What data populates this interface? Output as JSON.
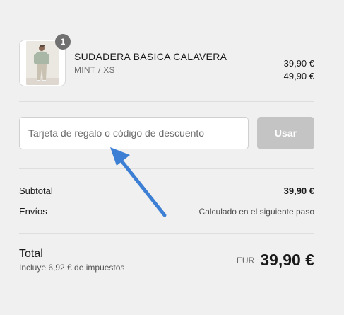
{
  "product": {
    "quantity": "1",
    "name": "SUDADERA BÁSICA CALAVERA",
    "variant": "MINT / XS",
    "price": "39,90 €",
    "original_price": "49,90 €",
    "image_icon": "product-photo"
  },
  "discount": {
    "placeholder": "Tarjeta de regalo o código de descuento",
    "value": "",
    "apply_label": "Usar"
  },
  "subtotal": {
    "label": "Subtotal",
    "value": "39,90 €"
  },
  "shipping": {
    "label": "Envíos",
    "value": "Calculado en el siguiente paso"
  },
  "total": {
    "label": "Total",
    "tax_note": "Incluye 6,92 € de impuestos",
    "currency": "EUR",
    "amount": "39,90 €"
  },
  "annotation": {
    "icon": "arrow-icon",
    "color": "#3d7fd4"
  },
  "colors": {
    "background": "#f0f0f0",
    "button_disabled": "#c4c4c4",
    "badge": "#707070"
  }
}
